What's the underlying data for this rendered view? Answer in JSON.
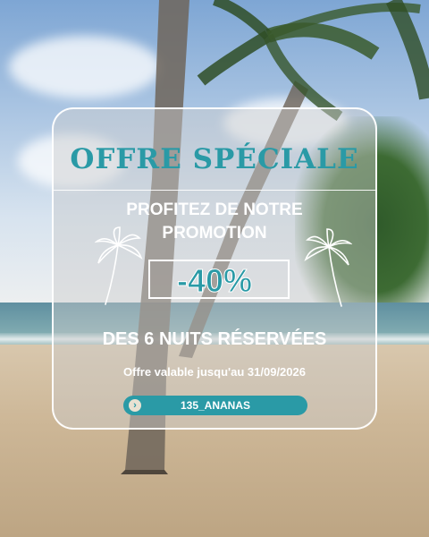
{
  "promo": {
    "title": "OFFRE SPÉCIALE",
    "subtitle_line1": "PROFITEZ DE NOTRE",
    "subtitle_line2": "PROMOTION",
    "discount": "-40%",
    "condition": "DES 6 NUITS RÉSERVÉES",
    "validity": "Offre valable jusqu'au 31/09/2026",
    "code": "135_ANANAS",
    "code_icon": "chevron-right-icon"
  },
  "colors": {
    "accent": "#2a9aa6",
    "text_light": "#ffffff"
  }
}
